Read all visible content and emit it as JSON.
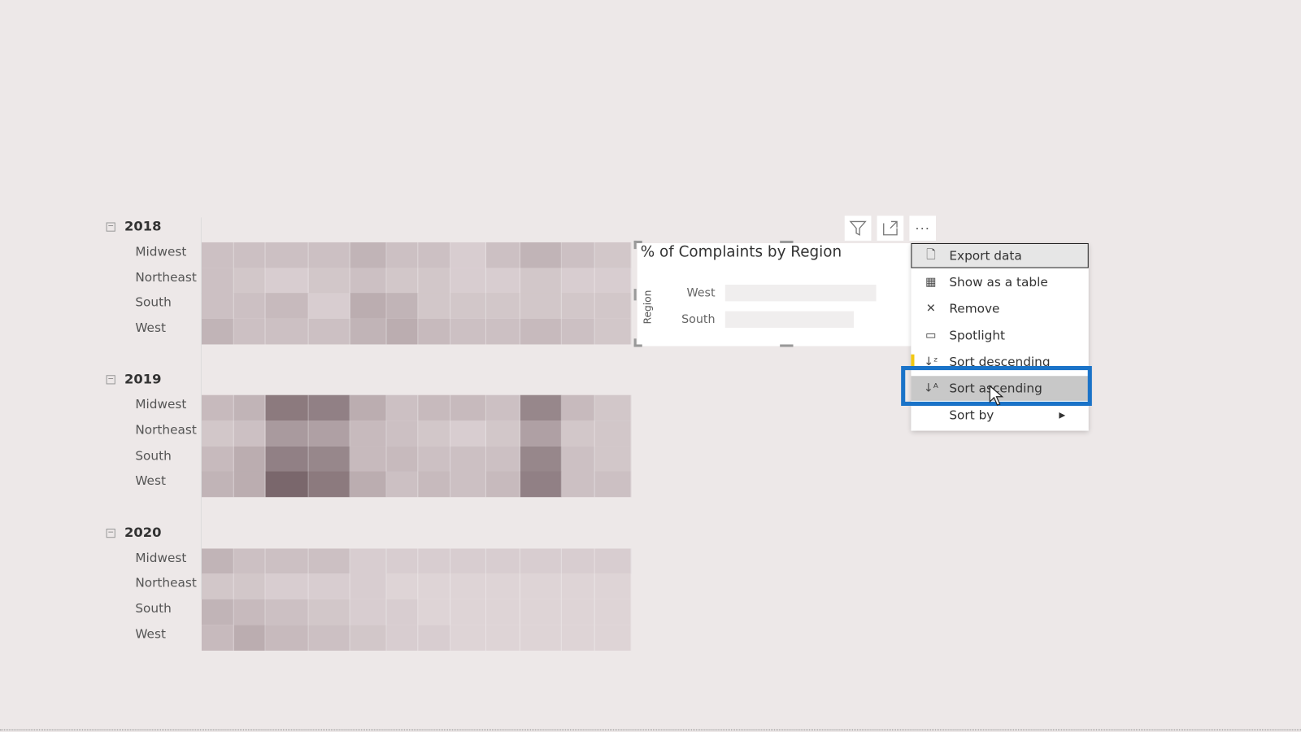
{
  "matrix": {
    "groups": [
      {
        "year": "2018",
        "rows": [
          {
            "label": "Midwest",
            "values": [
              0.2,
              0.2,
              0.2,
              0.2,
              0.3,
              0.2,
              0.2,
              0.1,
              0.2,
              0.3,
              0.2,
              0.15
            ]
          },
          {
            "label": "Northeast",
            "values": [
              0.2,
              0.15,
              0.1,
              0.15,
              0.2,
              0.15,
              0.15,
              0.1,
              0.1,
              0.15,
              0.1,
              0.1
            ]
          },
          {
            "label": "South",
            "values": [
              0.2,
              0.2,
              0.25,
              0.1,
              0.35,
              0.3,
              0.15,
              0.15,
              0.15,
              0.15,
              0.15,
              0.15
            ]
          },
          {
            "label": "West",
            "values": [
              0.3,
              0.2,
              0.2,
              0.2,
              0.3,
              0.35,
              0.25,
              0.2,
              0.2,
              0.25,
              0.2,
              0.15
            ]
          }
        ]
      },
      {
        "year": "2019",
        "rows": [
          {
            "label": "Midwest",
            "values": [
              0.25,
              0.3,
              0.75,
              0.7,
              0.35,
              0.2,
              0.25,
              0.25,
              0.2,
              0.65,
              0.25,
              0.15
            ]
          },
          {
            "label": "Northeast",
            "values": [
              0.15,
              0.2,
              0.5,
              0.45,
              0.25,
              0.2,
              0.15,
              0.1,
              0.15,
              0.45,
              0.15,
              0.15
            ]
          },
          {
            "label": "South",
            "values": [
              0.25,
              0.35,
              0.7,
              0.65,
              0.25,
              0.25,
              0.2,
              0.2,
              0.2,
              0.65,
              0.2,
              0.15
            ]
          },
          {
            "label": "West",
            "values": [
              0.3,
              0.35,
              0.9,
              0.75,
              0.35,
              0.2,
              0.25,
              0.2,
              0.25,
              0.7,
              0.2,
              0.2
            ]
          }
        ]
      },
      {
        "year": "2020",
        "rows": [
          {
            "label": "Midwest",
            "values": [
              0.3,
              0.2,
              0.2,
              0.2,
              0.1,
              0.1,
              0.1,
              0.1,
              0.1,
              0.1,
              0.1,
              0.1
            ]
          },
          {
            "label": "Northeast",
            "values": [
              0.15,
              0.15,
              0.1,
              0.1,
              0.1,
              0.05,
              0.05,
              0.05,
              0.05,
              0.05,
              0.05,
              0.05
            ]
          },
          {
            "label": "South",
            "values": [
              0.3,
              0.25,
              0.2,
              0.15,
              0.1,
              0.1,
              0.05,
              0.05,
              0.05,
              0.05,
              0.05,
              0.05
            ]
          },
          {
            "label": "West",
            "values": [
              0.25,
              0.35,
              0.25,
              0.2,
              0.15,
              0.1,
              0.1,
              0.05,
              0.05,
              0.05,
              0.05,
              0.05
            ]
          }
        ]
      }
    ],
    "color_low": "#e4dadc",
    "color_high": "#6e5a5f"
  },
  "chart": {
    "title": "% of Complaints by Region",
    "axis_label": "Region",
    "bars": [
      {
        "label": "West",
        "value": 1.0
      },
      {
        "label": "South",
        "value": 0.85
      }
    ],
    "bar_color": "#f0eeee"
  },
  "toolbar": {
    "filter_icon": "filter-icon",
    "focus_icon": "focus-mode-icon",
    "more_icon": "more-options-icon",
    "more_label": "···"
  },
  "context_menu": {
    "items": [
      {
        "label": "Export data",
        "icon": "export-data-icon"
      },
      {
        "label": "Show as a table",
        "icon": "show-table-icon"
      },
      {
        "label": "Remove",
        "icon": "close-icon"
      },
      {
        "label": "Spotlight",
        "icon": "spotlight-icon"
      },
      {
        "label": "Sort descending",
        "icon": "sort-descending-icon"
      },
      {
        "label": "Sort ascending",
        "icon": "sort-ascending-icon"
      },
      {
        "label": "Sort by",
        "icon": "chevron-right-icon"
      }
    ],
    "highlight_color": "#1a73c8",
    "active_marker_color": "#f2c811"
  }
}
